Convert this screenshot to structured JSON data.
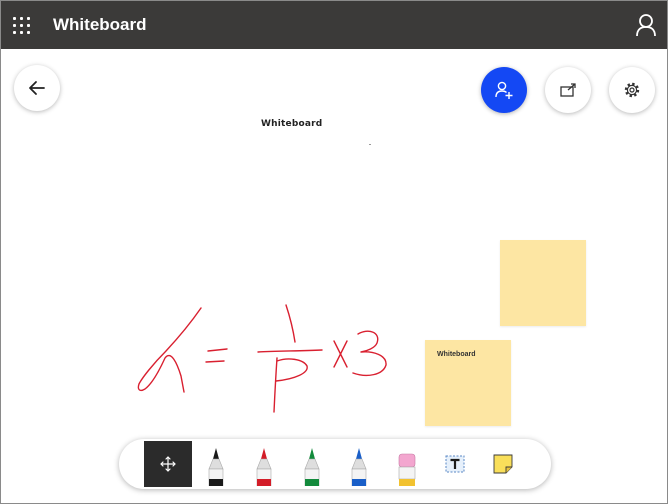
{
  "app": {
    "title": "Whiteboard"
  },
  "board": {
    "label": "Whiteboard",
    "notes": [
      {
        "text": ""
      },
      {
        "text": "Whiteboard"
      }
    ]
  },
  "colors": {
    "titlebar": "#3b3a39",
    "share_accent": "#1448f4",
    "ink": "#d92030",
    "sticky": "#fde6a3",
    "pen_black": "#1a1a1a",
    "pen_red": "#d31d28",
    "pen_green": "#138a3c",
    "pen_blue": "#1a5fc8",
    "eraser_pink": "#f3a6cf",
    "eraser_band": "#f2c230"
  },
  "icons": {
    "apps": "app-launcher-icon",
    "profile": "person-icon",
    "back": "arrow-left-icon",
    "share": "add-person-icon",
    "export": "export-icon",
    "settings": "gear-icon",
    "move": "move-icon",
    "text": "text-box-icon",
    "note": "sticky-note-icon"
  }
}
